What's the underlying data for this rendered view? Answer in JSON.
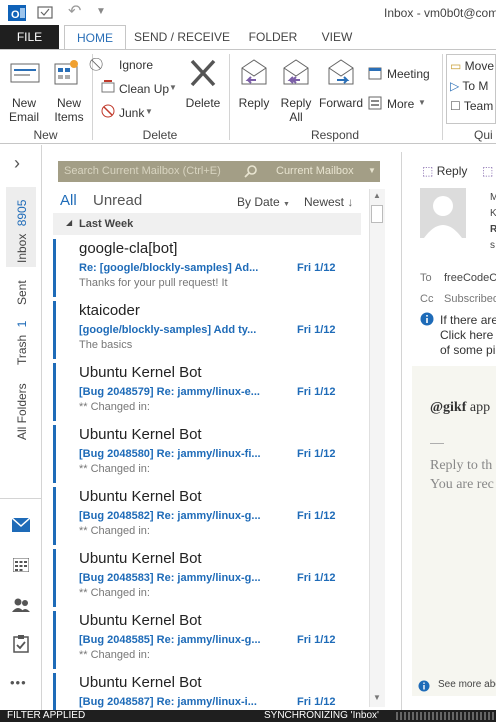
{
  "window": {
    "title": "Inbox - vm0b0t@com",
    "undo_glyph": "↶",
    "quick_save_glyph": "⛁"
  },
  "tabs": [
    {
      "label": "FILE"
    },
    {
      "label": "HOME"
    },
    {
      "label": "SEND / RECEIVE"
    },
    {
      "label": "FOLDER"
    },
    {
      "label": "VIEW"
    }
  ],
  "ribbon": {
    "new_email": "New\nEmail",
    "new_items": "New\nItems",
    "new_group": "New",
    "ignore": "Ignore",
    "clean_up": "Clean Up",
    "junk": "Junk",
    "delete": "Delete",
    "delete_group": "Delete",
    "reply": "Reply",
    "reply_all": "Reply\nAll",
    "forward": "Forward",
    "meeting": "Meeting",
    "more": "More",
    "respond_group": "Respond",
    "quick_move": "Move",
    "quick_to": "To M",
    "quick_team": "Team",
    "quick_group": "Qui",
    "colors": {
      "reply_arrow": "#7b5ea7",
      "forward_arrow": "#2a6fb7",
      "delete_x": "#555555"
    }
  },
  "leftnav": {
    "collapse_glyph": "›",
    "folders": [
      {
        "name": "Inbox",
        "count": "8905"
      },
      {
        "name": "Sent",
        "count": ""
      },
      {
        "name": "Trash",
        "count": "1"
      },
      {
        "name": "All Folders",
        "count": ""
      }
    ],
    "bottom_icons": [
      "mail-icon",
      "calendar-icon",
      "people-icon",
      "tasks-icon",
      "more-icon"
    ],
    "more_glyph": "•••"
  },
  "list": {
    "search_placeholder": "Search Current Mailbox (Ctrl+E)",
    "scope": "Current Mailbox",
    "filter_all": "All",
    "filter_unread": "Unread",
    "sort_by": "By Date",
    "sort_order": "Newest",
    "group_header": "Last Week",
    "messages": [
      {
        "from": "google-cla[bot]",
        "subject": "Re: [google/blockly-samples] Ad...",
        "date": "Fri 1/12",
        "preview": "Thanks for your pull request! It"
      },
      {
        "from": "ktaicoder",
        "subject": "[google/blockly-samples] Add ty...",
        "date": "Fri 1/12",
        "preview": "The basics"
      },
      {
        "from": "Ubuntu Kernel Bot",
        "subject": "[Bug 2048579] Re: jammy/linux-e...",
        "date": "Fri 1/12",
        "preview": "** Changed in:"
      },
      {
        "from": "Ubuntu Kernel Bot",
        "subject": "[Bug 2048580] Re: jammy/linux-fi...",
        "date": "Fri 1/12",
        "preview": "** Changed in:"
      },
      {
        "from": "Ubuntu Kernel Bot",
        "subject": "[Bug 2048582] Re: jammy/linux-g...",
        "date": "Fri 1/12",
        "preview": "** Changed in:"
      },
      {
        "from": "Ubuntu Kernel Bot",
        "subject": "[Bug 2048583] Re: jammy/linux-g...",
        "date": "Fri 1/12",
        "preview": "** Changed in:"
      },
      {
        "from": "Ubuntu Kernel Bot",
        "subject": "[Bug 2048585] Re: jammy/linux-g...",
        "date": "Fri 1/12",
        "preview": "** Changed in:"
      },
      {
        "from": "Ubuntu Kernel Bot",
        "subject": "[Bug 2048587] Re: jammy/linux-i...",
        "date": "Fri 1/12",
        "preview": ""
      }
    ]
  },
  "reading": {
    "reply": "Reply",
    "to_label": "To",
    "to_value": "freeCodeC",
    "cc_label": "Cc",
    "cc_value": "Subscribed",
    "info_line1": "If there are",
    "info_line2": "Click here t",
    "info_line3": "of some pi",
    "body_mention": "@gikf",
    "body_mention_rest": "app",
    "dash": "—",
    "reply_line1": "Reply to th",
    "reply_line2": "You are rec",
    "see_more": "See more abou",
    "sender_initial_lines": [
      "M",
      "K",
      "R",
      "s"
    ]
  },
  "status": {
    "left": "FILTER APPLIED",
    "right": "SYNCHRONIZING 'Inbox'"
  }
}
